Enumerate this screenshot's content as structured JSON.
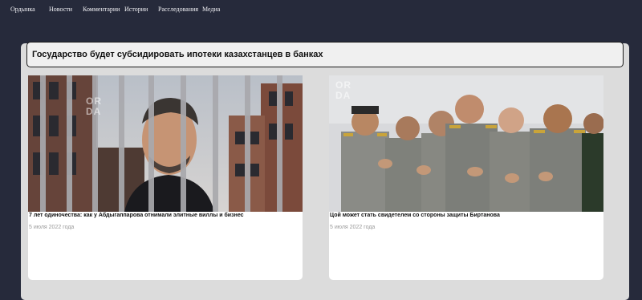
{
  "nav": {
    "items": [
      {
        "label": "Ордынка"
      },
      {
        "label": "Новости"
      },
      {
        "label": "Комментарии"
      },
      {
        "label": "Истории"
      },
      {
        "label": "Расследования"
      },
      {
        "label": "Медиа"
      }
    ]
  },
  "headline": {
    "text": "Государство будет субсидировать ипотеки казахстанцев в банках"
  },
  "cards": [
    {
      "title": "7 лет одиночества: как у Абдыгаппарова отнимали элитные виллы и бизнес",
      "date": "5 июля 2022 года",
      "watermark": [
        "OR",
        "DA"
      ]
    },
    {
      "title": "Цой может стать свидетелем со стороны защиты Биртанова",
      "date": "5 июля 2022 года",
      "watermark": [
        "OR",
        "DA"
      ]
    }
  ],
  "colors": {
    "background": "#262a3b",
    "panel": "#dcdcdc",
    "card": "#ffffff",
    "date": "#9a9a9a"
  }
}
